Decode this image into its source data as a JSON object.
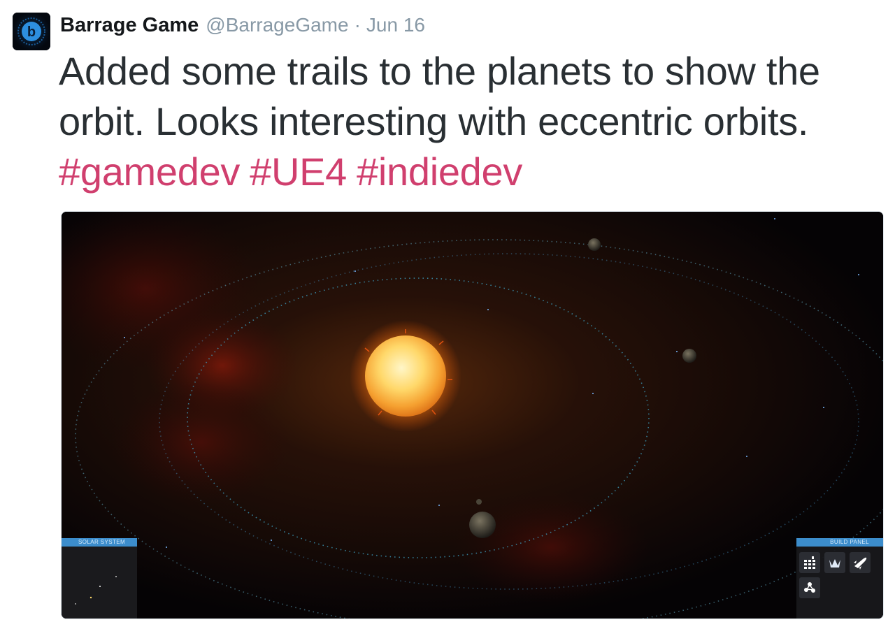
{
  "tweet": {
    "author_name": "Barrage Game",
    "author_handle": "@BarrageGame",
    "separator": "·",
    "date": "Jun 16",
    "avatar_icon": "barrage-b-logo-icon",
    "text_line1": "Added some trails to the planets to show the",
    "text_line2": "orbit. Looks interesting with eccentric orbits.",
    "hashtags": [
      "#gamedev",
      "#UE4",
      "#indiedev"
    ],
    "hashtag_color": "#d03f6e"
  },
  "game_ui": {
    "solar_system_panel_title": "SOLAR SYSTEM",
    "build_panel_title": "BUILD PANEL",
    "build_buttons": [
      {
        "icon": "grid-building-icon"
      },
      {
        "icon": "crown-structure-icon"
      },
      {
        "icon": "rocket-icon"
      },
      {
        "icon": "molecule-icon"
      }
    ],
    "panel_accent_color": "#3c8dcc"
  }
}
